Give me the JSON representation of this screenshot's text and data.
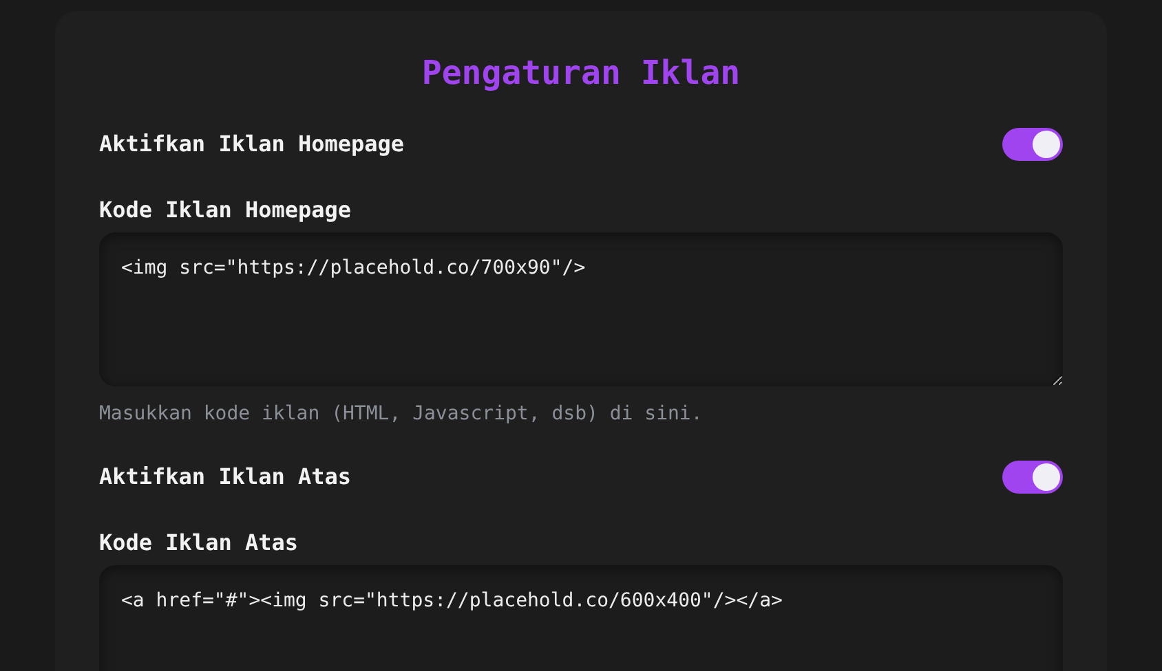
{
  "title": "Pengaturan Iklan",
  "sections": [
    {
      "toggle_label": "Aktifkan Iklan Homepage",
      "on": true,
      "code_label": "Kode Iklan Homepage",
      "code_value": "<img src=\"https://placehold.co/700x90\"/>",
      "help": "Masukkan kode iklan (HTML, Javascript, dsb) di sini."
    },
    {
      "toggle_label": "Aktifkan Iklan Atas",
      "on": true,
      "code_label": "Kode Iklan Atas",
      "code_value": "<a href=\"#\"><img src=\"https://placehold.co/600x400\"/></a>"
    }
  ]
}
